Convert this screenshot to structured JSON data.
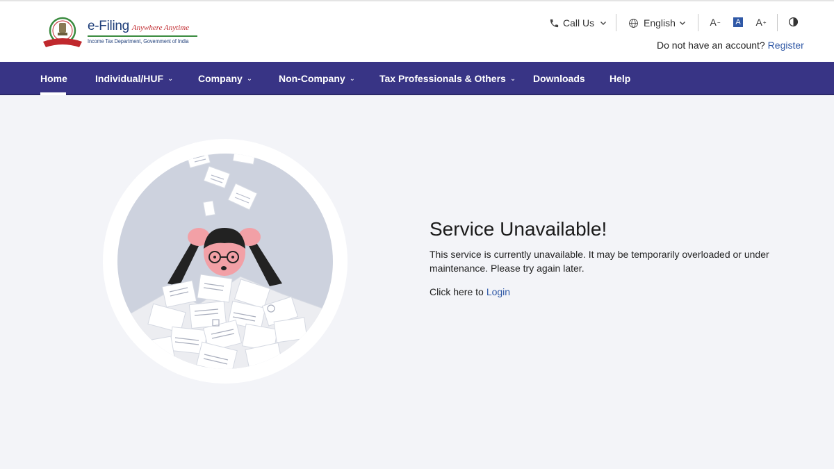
{
  "header": {
    "logo_title": "e-Filing",
    "logo_tagline": "Anywhere Anytime",
    "logo_subtitle": "Income Tax Department, Government of India",
    "call_us": "Call Us",
    "language": "English",
    "font_decrease": "A",
    "font_default": "A",
    "font_increase": "A",
    "account_prompt": "Do not have an account?",
    "register": "Register"
  },
  "nav": {
    "items": [
      {
        "label": "Home",
        "active": true
      },
      {
        "label": "Individual/HUF",
        "dropdown": true
      },
      {
        "label": "Company",
        "dropdown": true
      },
      {
        "label": "Non-Company",
        "dropdown": true
      },
      {
        "label": "Tax Professionals & Others",
        "dropdown": true
      },
      {
        "label": "Downloads"
      },
      {
        "label": "Help"
      }
    ]
  },
  "message": {
    "title": "Service Unavailable!",
    "body": "This service is currently unavailable. It may be temporarily overloaded or under maintenance. Please try again later.",
    "login_prompt": "Click here to",
    "login_link": "Login"
  },
  "colors": {
    "nav_bg": "#383485",
    "link": "#2f58a6",
    "page_bg": "#f3f4f8"
  },
  "icons": [
    "phone-icon",
    "globe-icon",
    "chevron-down-icon",
    "contrast-icon",
    "emblem-icon"
  ]
}
